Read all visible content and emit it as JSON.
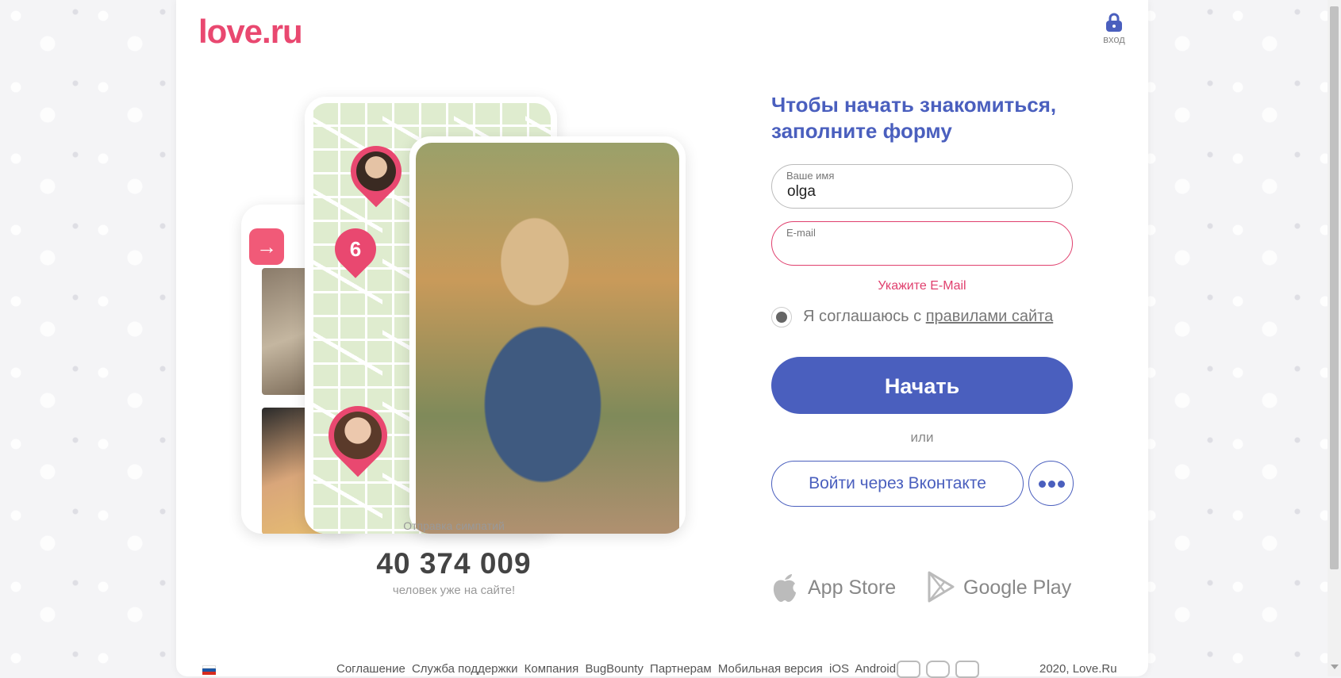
{
  "header": {
    "logo": "love.ru",
    "login_label": "вход"
  },
  "promo": {
    "sympathy_label": "Отправка симпатий",
    "map_pin_number": "6",
    "users_count": "40 374 009",
    "users_label": "человек уже на сайте!"
  },
  "form": {
    "title": "Чтобы начать знакомиться, заполните форму",
    "name_label": "Ваше имя",
    "name_value": "olga",
    "email_label": "E-mail",
    "email_value": "",
    "email_error": "Укажите E-Mail",
    "agree_text": "Я соглашаюсь с ",
    "agree_link": "правилами сайта",
    "submit_label": "Начать",
    "or_label": "или",
    "vk_label": "Войти через Вконтакте"
  },
  "stores": {
    "apple": "App Store",
    "google": "Google Play"
  },
  "footer": {
    "links": [
      "Соглашение",
      "Служба поддержки",
      "Компания",
      "BugBounty",
      "Партнерам",
      "Мобильная версия",
      "iOS",
      "Android"
    ],
    "social_icons": [
      "youtube-icon",
      "instagram-icon",
      "vk-icon"
    ],
    "copyright": "2020, Love.Ru",
    "flag_colors": [
      "#ffffff",
      "#1c57a5",
      "#d52b1e"
    ]
  },
  "colors": {
    "brand_pink": "#e94870",
    "primary_blue": "#4a5fbe",
    "error": "#e0406e"
  }
}
